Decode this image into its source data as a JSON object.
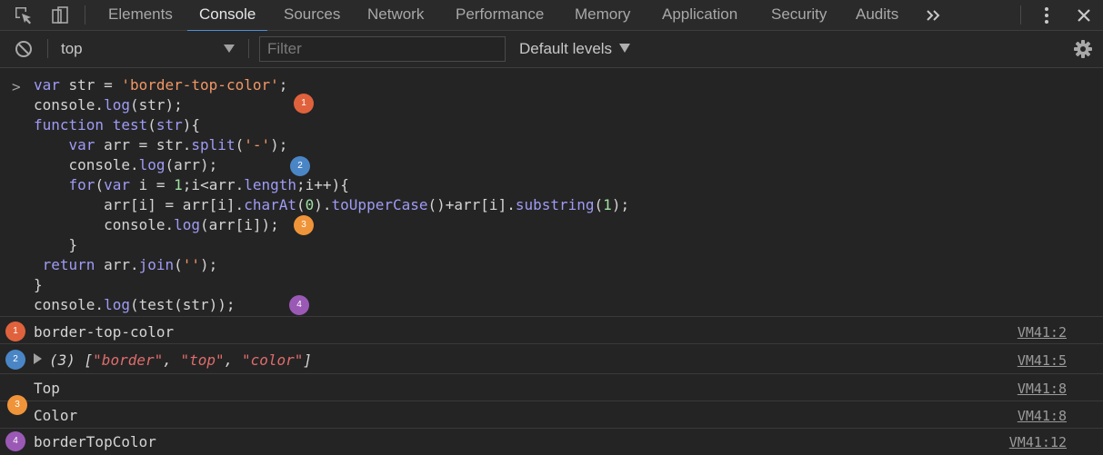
{
  "tabs": [
    {
      "label": "Elements"
    },
    {
      "label": "Console"
    },
    {
      "label": "Sources"
    },
    {
      "label": "Network"
    },
    {
      "label": "Performance"
    },
    {
      "label": "Memory"
    },
    {
      "label": "Application"
    },
    {
      "label": "Security"
    },
    {
      "label": "Audits"
    }
  ],
  "active_tab": "Console",
  "toolbar": {
    "context": "top",
    "filter_placeholder": "Filter",
    "levels": "Default levels"
  },
  "code": {
    "l1a": "var",
    "l1b": " str = ",
    "l1c": "'border-top-color'",
    "l1d": ";",
    "l2a": "console.",
    "l2b": "log",
    "l2c": "(str);",
    "l3a": "function",
    "l3b": " ",
    "l3c": "test",
    "l3d": "(",
    "l3e": "str",
    "l3f": "){",
    "l4a": "    var",
    "l4b": " arr = str.",
    "l4c": "split",
    "l4d": "(",
    "l4e": "'-'",
    "l4f": ");",
    "l5a": "    console.",
    "l5b": "log",
    "l5c": "(arr);",
    "l6a": "    for",
    "l6b": "(",
    "l6c": "var",
    "l6d": " i = ",
    "l6e": "1",
    "l6f": ";i<arr.",
    "l6g": "length",
    "l6h": ";i++){",
    "l7a": "        arr[i] = arr[i].",
    "l7b": "charAt",
    "l7c": "(",
    "l7d": "0",
    "l7e": ").",
    "l7f": "toUpperCase",
    "l7g": "()+arr[i].",
    "l7h": "substring",
    "l7i": "(",
    "l7j": "1",
    "l7k": ");",
    "l8a": "        console.",
    "l8b": "log",
    "l8c": "(arr[i]);",
    "l9": "    }",
    "l10a": " return",
    "l10b": " arr.",
    "l10c": "join",
    "l10d": "(",
    "l10e": "''",
    "l10f": ");",
    "l11": "}",
    "l12a": "console.",
    "l12b": "log",
    "l12c": "(test(str));"
  },
  "badges": {
    "b1": "1",
    "b2": "2",
    "b3": "3",
    "b4": "4"
  },
  "badge_colors": {
    "b1": "#e0623d",
    "b2": "#4a86c6",
    "b3": "#f0943a",
    "b4": "#9b59b6"
  },
  "output": {
    "r1": {
      "text": "border-top-color",
      "src": "VM41:2"
    },
    "r2": {
      "count": "(3) ",
      "open": "[",
      "s1": "\"border\"",
      "sep1": ", ",
      "s2": "\"top\"",
      "sep2": ", ",
      "s3": "\"color\"",
      "close": "]",
      "src": "VM41:5"
    },
    "r3": {
      "text": "Top",
      "src": "VM41:8"
    },
    "r4": {
      "text": "Color",
      "src": "VM41:8"
    },
    "r5": {
      "text": "borderTopColor",
      "src": "VM41:12"
    }
  }
}
